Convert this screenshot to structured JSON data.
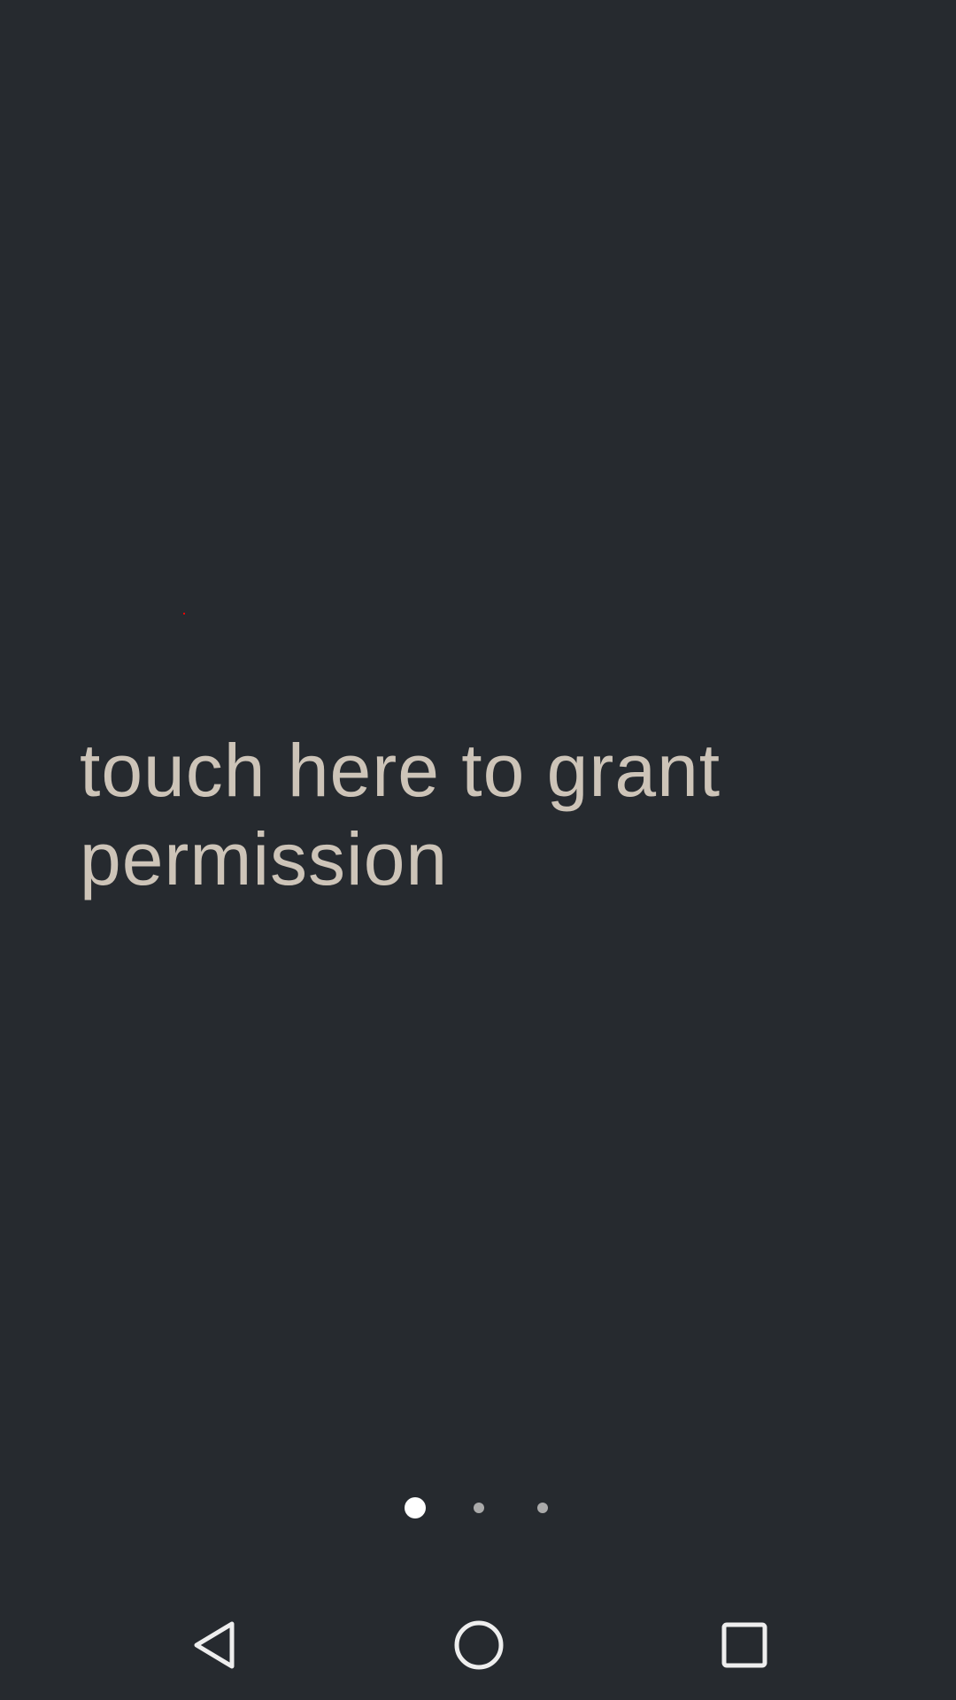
{
  "main": {
    "grant_text": "touch here to grant permission"
  },
  "pager": {
    "page_count": 3,
    "active_index": 0
  },
  "colors": {
    "background": "#262a2f",
    "text": "#cdc4b8",
    "dot_active": "#ffffff",
    "dot_inactive": "#aaaaaa"
  },
  "nav": {
    "icons": [
      "back-icon",
      "home-icon",
      "recents-icon"
    ]
  }
}
